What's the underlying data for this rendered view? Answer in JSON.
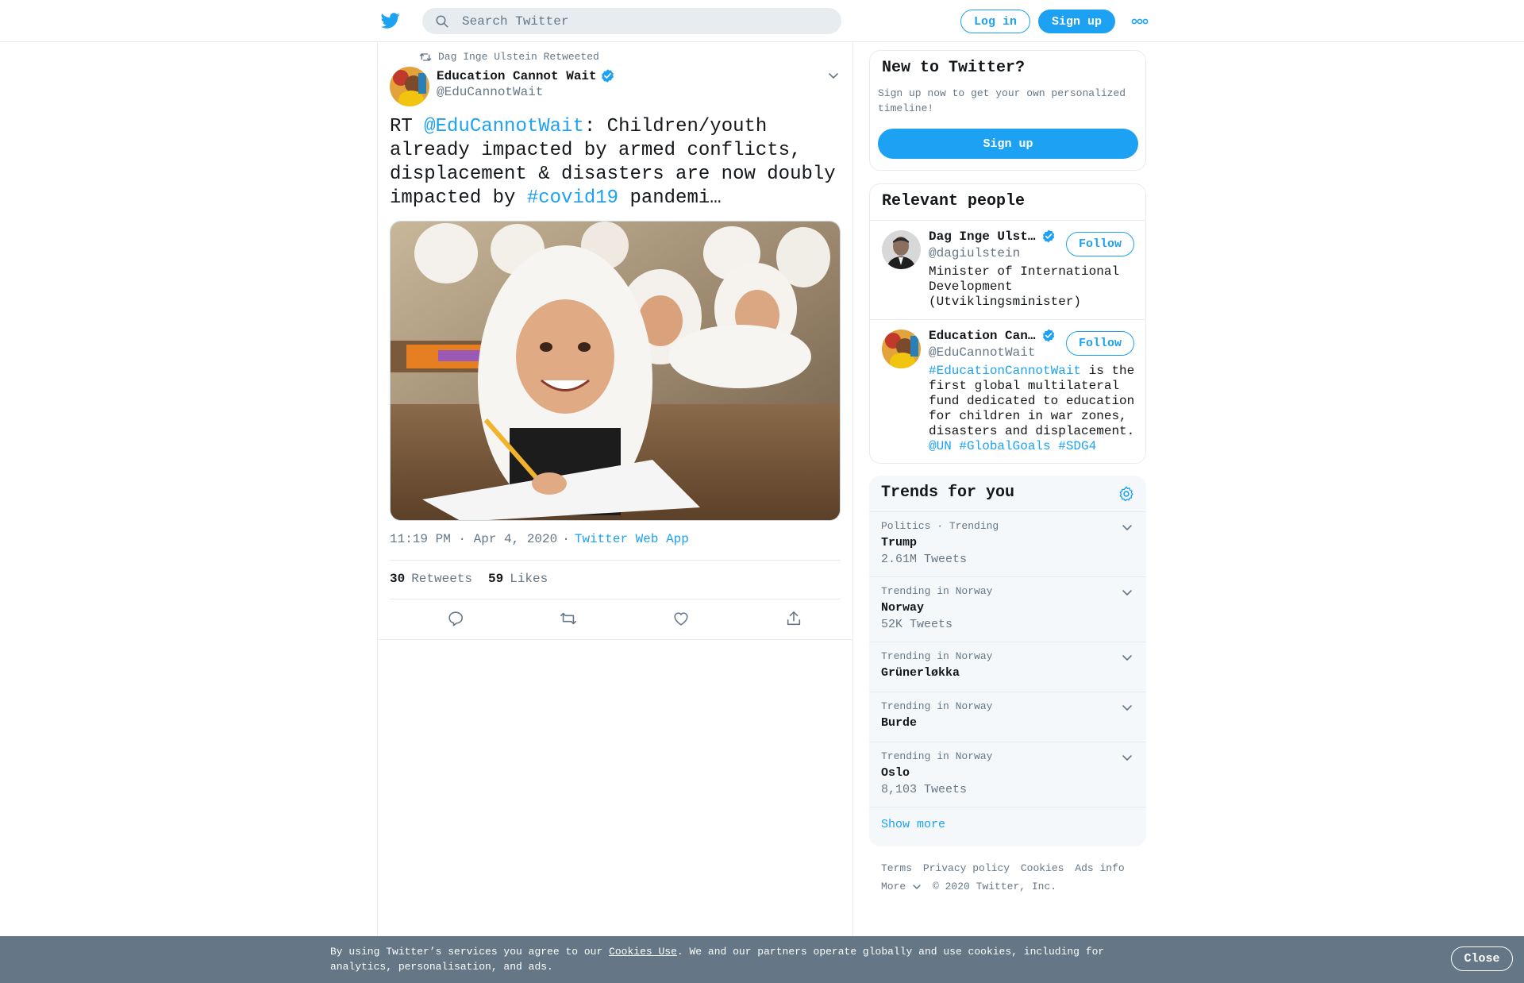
{
  "header": {
    "logo": "twitter-bird-icon",
    "search_placeholder": "Search Twitter",
    "login_label": "Log in",
    "signup_label": "Sign up",
    "more_icon": "more-icon"
  },
  "tweet": {
    "retweeted_by": "Dag Inge Ulstein Retweeted",
    "author_name": "Education Cannot Wait",
    "author_handle": "@EduCannotWait",
    "text_prefix": "RT ",
    "text_mention": "@EduCannotWait",
    "text_middle": ": Children/youth already impacted by armed conflicts, displacement & disasters are now doubly impacted by ",
    "text_hashtag": "#covid19",
    "text_suffix": " pandemi…",
    "time": "11:19 PM · Apr 4, 2020",
    "separator": "·",
    "source": "Twitter Web App",
    "retweets_count": "30",
    "retweets_label": "Retweets",
    "likes_count": "59",
    "likes_label": "Likes",
    "actions": [
      "reply-icon",
      "retweet-icon",
      "like-icon",
      "share-icon"
    ]
  },
  "new_to_twitter": {
    "title": "New to Twitter?",
    "subtitle": "Sign up now to get your own personalized timeline!",
    "signup_label": "Sign up"
  },
  "relevant_people": {
    "title": "Relevant people",
    "people": [
      {
        "name": "Dag Inge Ulste…",
        "handle": "@dagiulstein",
        "bio": "Minister of International Development (Utviklingsminister)",
        "follow_label": "Follow"
      },
      {
        "name": "Education Cann…",
        "handle": "@EduCannotWait",
        "bio_link": "#EducationCannotWait",
        "bio": " is the first global multilateral fund dedicated to education for children in war zones, disasters and displacement.",
        "bio_links_end": "@UN #GlobalGoals #SDG4",
        "follow_label": "Follow"
      }
    ]
  },
  "trends": {
    "title": "Trends for you",
    "items": [
      {
        "context": "Politics · Trending",
        "name": "Trump",
        "count": "2.61M Tweets"
      },
      {
        "context": "Trending in Norway",
        "name": "Norway",
        "count": "52K Tweets"
      },
      {
        "context": "Trending in Norway",
        "name": "Grünerløkka",
        "count": ""
      },
      {
        "context": "Trending in Norway",
        "name": "Burde",
        "count": ""
      },
      {
        "context": "Trending in Norway",
        "name": "Oslo",
        "count": "8,103 Tweets"
      }
    ],
    "show_more": "Show more"
  },
  "footer": {
    "terms": "Terms",
    "privacy": "Privacy policy",
    "cookies": "Cookies",
    "ads": "Ads info",
    "more": "More",
    "copyright": "© 2020 Twitter, Inc."
  },
  "cookie_bar": {
    "text_before": "By using Twitter’s services you agree to our ",
    "link": "Cookies Use",
    "text_after": ". We and our partners operate globally and use cookies, including for analytics, personalisation, and ads.",
    "close_label": "Close"
  },
  "colors": {
    "accent": "#1da1f2",
    "secondary_text": "#657786",
    "cookie_bar_bg": "#657786"
  }
}
